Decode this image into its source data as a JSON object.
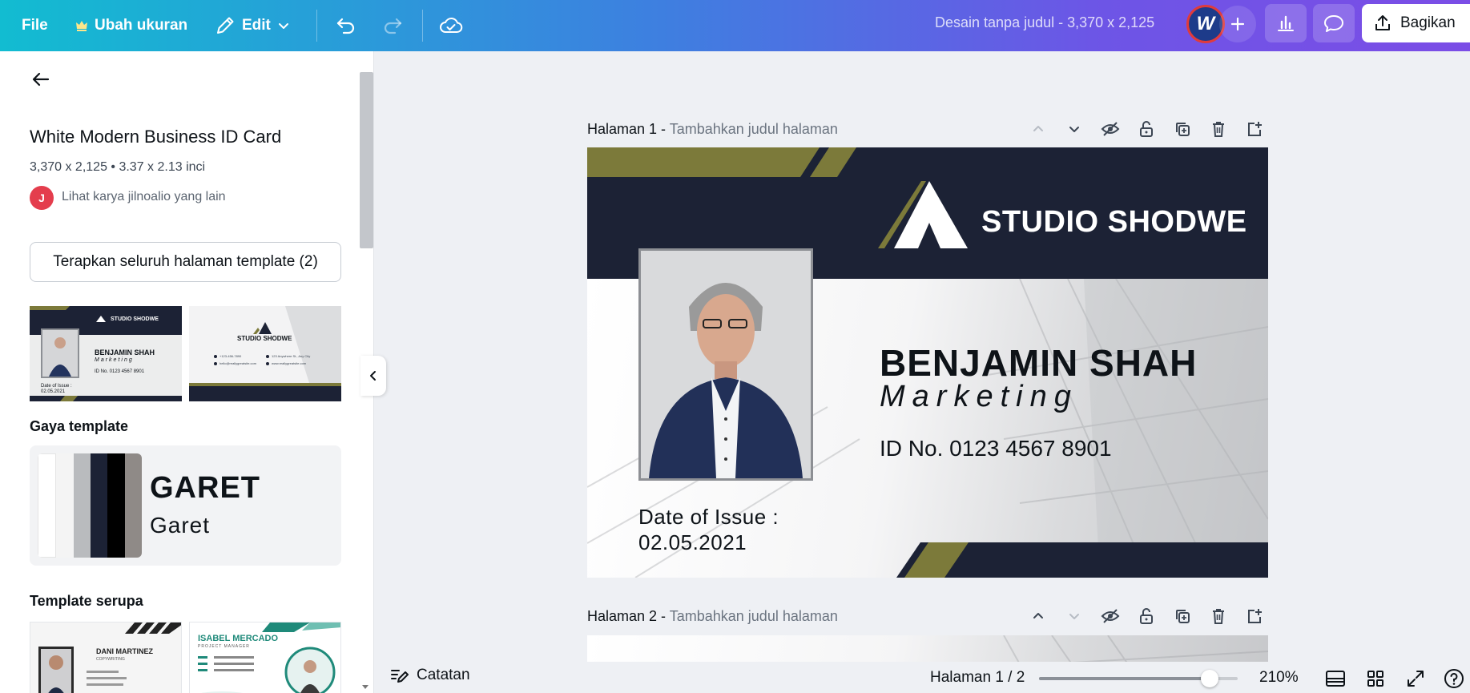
{
  "topbar": {
    "file_label": "File",
    "resize_label": "Ubah ukuran",
    "edit_label": "Edit",
    "doc_title": "Desain tanpa judul - 3,370 x 2,125",
    "avatar_letter": "W",
    "share_label": "Bagikan",
    "icons": [
      "crown-icon",
      "pencil-icon",
      "chevron-down-icon",
      "undo-icon",
      "redo-icon",
      "cloud-check-icon",
      "plus-icon",
      "chart-icon",
      "comment-icon",
      "share-icon"
    ]
  },
  "left_panel": {
    "template_title": "White Modern Business ID Card",
    "template_size": "3,370 x 2,125 • 3.37 x 2.13 inci",
    "author_initial": "J",
    "author_link": "Lihat karya jilnoalio yang lain",
    "apply_button": "Terapkan seluruh halaman template (2)",
    "style_section_title": "Gaya template",
    "style_font_upper": "GARET",
    "style_font_regular": "Garet",
    "style_swatches": [
      "#ffffff",
      "#f4f4f4",
      "#b9bbbe",
      "#1c2235",
      "#000000",
      "#8f8a87"
    ],
    "similar_section_title": "Template serupa",
    "thumb1": {
      "studio": "STUDIO SHODWE",
      "name": "BENJAMIN SHAH",
      "role": "Marketing",
      "id": "ID No. 0123 4567 8901",
      "issue": "Date of Issue :",
      "date": "02.05.2021"
    },
    "thumb2": {
      "studio": "STUDIO SHODWE",
      "phone": "+123-456-7890",
      "address": "123 Anywhere St., Any City",
      "email": "hello@reallygreatsite.com",
      "site": "www.reallygreatsite.com"
    },
    "similar1": {
      "name": "DANI MARTINEZ",
      "role": "COPYWRITING"
    },
    "similar2": {
      "name": "ISABEL MERCADO",
      "role": "PROJECT MANAGER"
    }
  },
  "pages": [
    {
      "label": "Halaman 1 -",
      "sublabel": "Tambahkan judul halaman"
    },
    {
      "label": "Halaman 2 -",
      "sublabel": "Tambahkan judul halaman"
    }
  ],
  "card": {
    "studio_name": "STUDIO SHODWE",
    "person_name": "BENJAMIN SHAH",
    "person_role": "Marketing",
    "person_id": "ID No. 0123 4567 8901",
    "issue_label": "Date of Issue :",
    "issue_date": "02.05.2021",
    "colors": {
      "navy": "#1c2235",
      "olive": "#7c7a3a"
    }
  },
  "bottombar": {
    "notes_label": "Catatan",
    "page_count": "Halaman 1 / 2",
    "zoom_label": "210%",
    "zoom_position": 0.86
  }
}
